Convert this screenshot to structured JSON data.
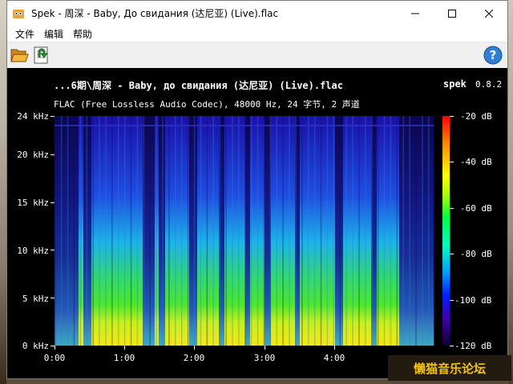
{
  "window": {
    "title": "Spek - 周深 - Baby, До свидания (达尼亚) (Live).flac",
    "controls": [
      "minimize",
      "maximize",
      "close"
    ]
  },
  "menu": {
    "items": [
      "文件",
      "编辑",
      "帮助"
    ]
  },
  "toolbar": {
    "open_icon": "folder-open-icon",
    "save_icon": "save-export-icon",
    "help_icon": "help-icon"
  },
  "spectrum": {
    "file_label": "...6期\\周深 - Baby, до свидания (达尼亚) (Live).flac",
    "app_name": "spek",
    "app_version": "0.8.2",
    "info": "FLAC (Free Lossless Audio Codec), 48000 Hz, 24 字节, 2 声道"
  },
  "chart_data": {
    "type": "heatmap",
    "title": "...6期\\周深 - Baby, до свидания (达尼亚) (Live).flac",
    "xlabel": "",
    "ylabel": "",
    "x_ticks": [
      "0:00",
      "1:00",
      "2:00",
      "3:00",
      "4:00"
    ],
    "y_ticks": [
      "0 kHz",
      "5 kHz",
      "10 kHz",
      "15 kHz",
      "20 kHz",
      "24 kHz"
    ],
    "ylim": [
      0,
      24
    ],
    "colorbar_ticks": [
      "-20 dB",
      "-40 dB",
      "-60 dB",
      "-80 dB",
      "-100 dB",
      "-120 dB"
    ],
    "colorbar_range": [
      -120,
      -20
    ]
  },
  "watermark": {
    "text": "懒猫音乐论坛"
  }
}
